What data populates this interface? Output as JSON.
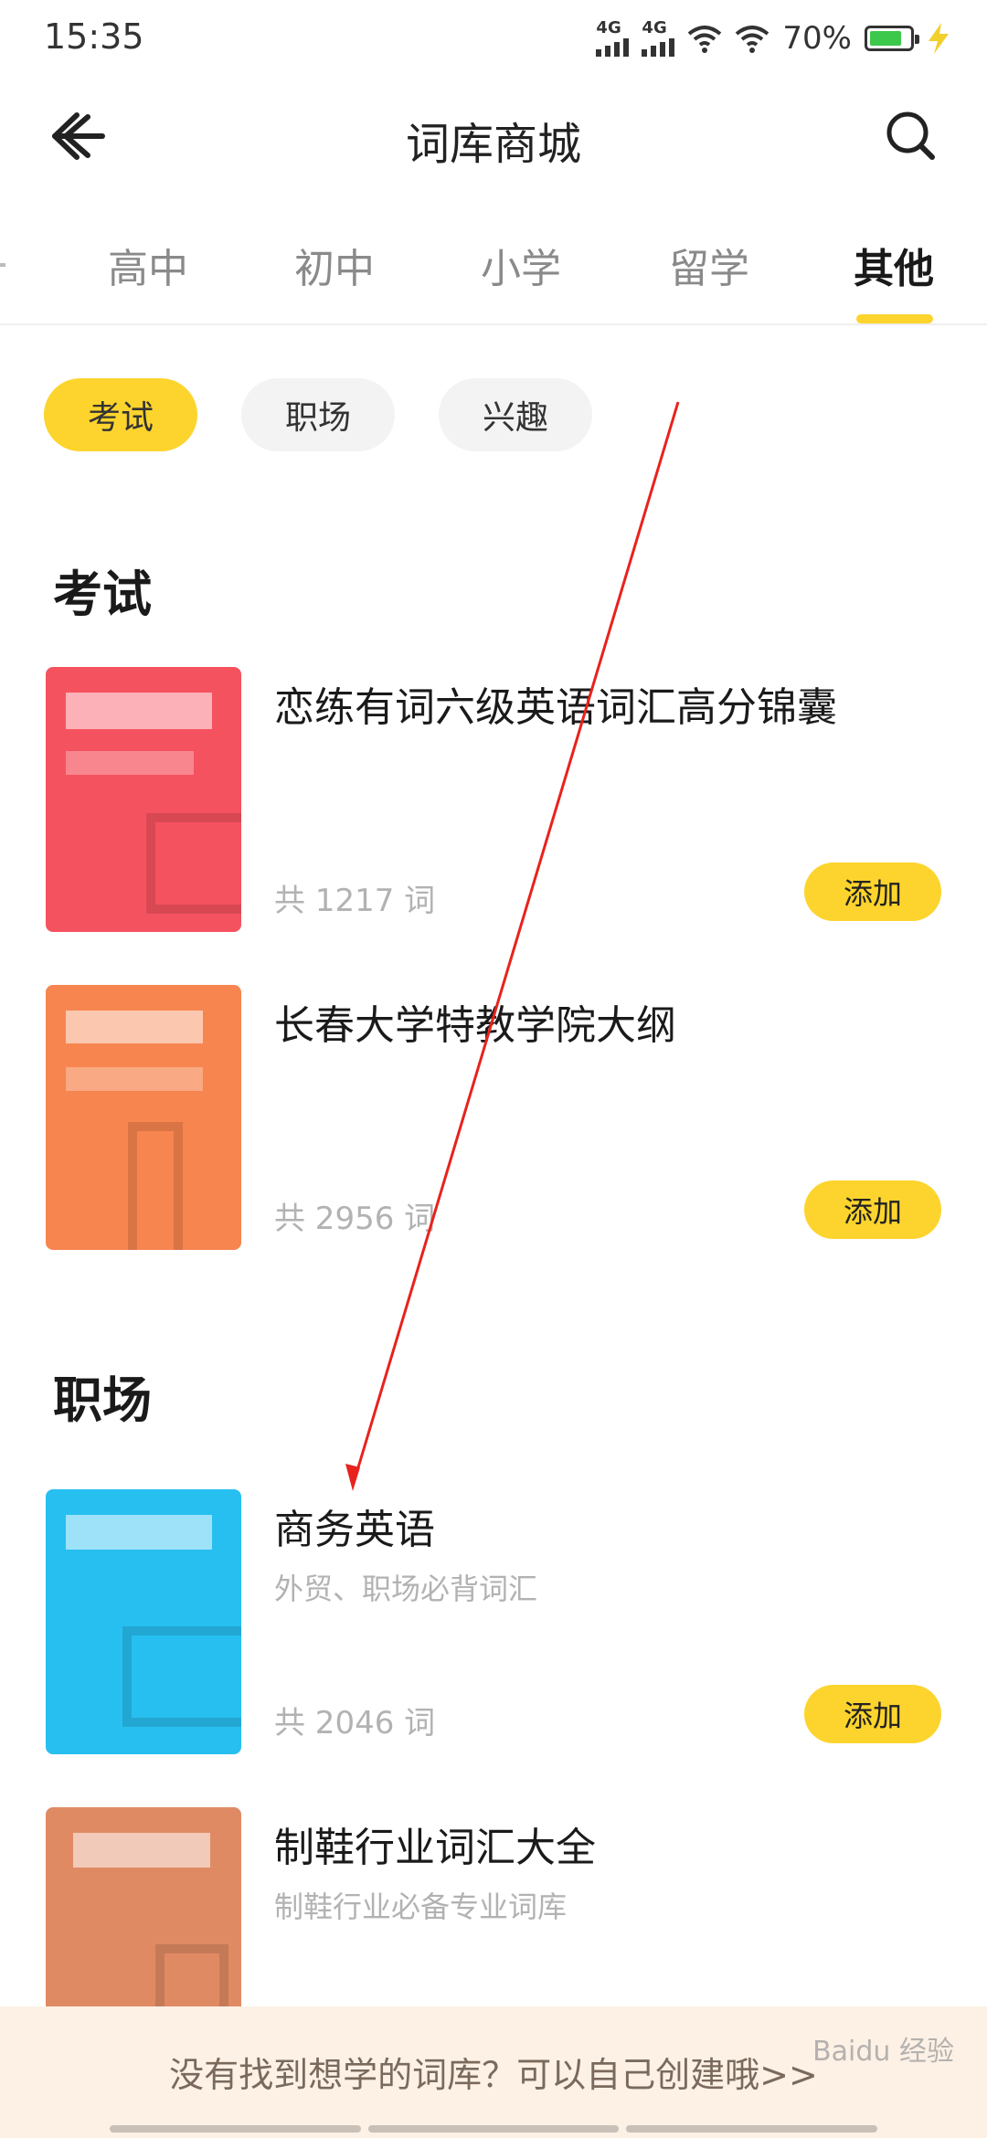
{
  "status_bar": {
    "time": "15:35",
    "signal1": "4G",
    "signal2": "4G",
    "battery": "70%"
  },
  "header": {
    "title": "词库商城",
    "back_icon": "arrow-left-icon",
    "search_icon": "search-icon"
  },
  "tabs": [
    {
      "label": "高中",
      "active": false
    },
    {
      "label": "初中",
      "active": false
    },
    {
      "label": "小学",
      "active": false
    },
    {
      "label": "留学",
      "active": false
    },
    {
      "label": "其他",
      "active": true
    }
  ],
  "chips": [
    {
      "label": "考试",
      "active": true
    },
    {
      "label": "职场",
      "active": false
    },
    {
      "label": "兴趣",
      "active": false
    }
  ],
  "sections": [
    {
      "title": "考试",
      "books": [
        {
          "name": "恋练有词六级英语词汇高分锦囊",
          "subtitle": "",
          "count": "共 1217 词",
          "button": "添加",
          "cover_color": "#f5525f"
        },
        {
          "name": "长春大学特教学院大纲",
          "subtitle": "",
          "count": "共 2956 词",
          "button": "添加",
          "cover_color": "#f7854f"
        }
      ]
    },
    {
      "title": "职场",
      "books": [
        {
          "name": "商务英语",
          "subtitle": "外贸、职场必背词汇",
          "count": "共 2046 词",
          "button": "添加",
          "cover_color": "#27bff0"
        },
        {
          "name": "制鞋行业词汇大全",
          "subtitle": "制鞋行业必备专业词库",
          "count": "",
          "button": "",
          "cover_color": "#e08a64"
        }
      ]
    }
  ],
  "banner": {
    "text": "没有找到想学的词库？可以自己创建哦>>"
  },
  "watermark": "Baidu 经验",
  "colors": {
    "accent": "#fcd42d",
    "annotation_arrow": "#e8221d"
  }
}
